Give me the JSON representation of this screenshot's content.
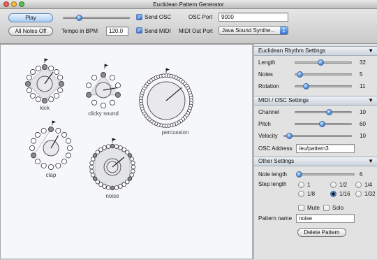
{
  "window": {
    "title": "Euclidean Pattern Generator"
  },
  "toolbar": {
    "play_label": "Play",
    "all_notes_off_label": "All Notes Off",
    "tempo_label": "Tempo in BPM",
    "tempo_value": "120.0",
    "send_osc_label": "Send OSC",
    "send_osc_checked": true,
    "send_midi_label": "Send MIDI",
    "send_midi_checked": true,
    "osc_port_label": "OSC Port",
    "osc_port_value": "9000",
    "midi_out_port_label": "MIDI Out Port",
    "midi_out_port_value": "Java Sound Synthe...",
    "volume_fraction": 0.24
  },
  "patterns": [
    {
      "name": "kick",
      "steps": 16,
      "hits": [
        0,
        4,
        8,
        12
      ],
      "shape": "square-ish"
    },
    {
      "name": "clicky sound",
      "steps": 10,
      "hits": [
        0,
        3,
        7
      ],
      "shape": "triangle"
    },
    {
      "name": "percussion",
      "steps": 60,
      "hits": [],
      "shape": "ring"
    },
    {
      "name": "clap",
      "steps": 16,
      "hits": [
        0,
        11
      ],
      "shape": "line"
    },
    {
      "name": "noise",
      "steps": 32,
      "hits": [
        0,
        5,
        11,
        16,
        21,
        27
      ],
      "shape": "hexagon"
    }
  ],
  "euclidean_settings": {
    "header": "Euclidean Rhythm Settings",
    "length_label": "Length",
    "length_value": "32",
    "length_fraction": 0.45,
    "notes_label": "Notes",
    "notes_value": "5",
    "notes_fraction": 0.08,
    "rotation_label": "Rotation",
    "rotation_value": "11",
    "rotation_fraction": 0.2
  },
  "midi_osc_settings": {
    "header": "MIDI / OSC Settings",
    "channel_label": "Channel",
    "channel_value": "10",
    "channel_fraction": 0.6,
    "pitch_label": "Pitch",
    "pitch_value": "60",
    "pitch_fraction": 0.47,
    "velocity_label": "Velocity",
    "velocity_value": "10",
    "velocity_fraction": 0.08,
    "osc_address_label": "OSC Address",
    "osc_address_value": "/eu/pattern3"
  },
  "other_settings": {
    "header": "Other Settings",
    "note_length_label": "Note length",
    "note_length_value": "6",
    "note_length_fraction": 0.03,
    "step_length_label": "Step length",
    "step_options": [
      "1",
      "1/2",
      "1/4",
      "1/8",
      "1/16",
      "1/32"
    ],
    "step_selected": "1/16",
    "mute_label": "Mute",
    "solo_label": "Solo",
    "mute_checked": false,
    "solo_checked": false,
    "pattern_name_label": "Pattern name",
    "pattern_name_value": "noise",
    "delete_button_label": "Delete Pattern"
  },
  "colors": {
    "slider_knob": "#4f8fd8",
    "hit_fill": "#8a8a8a",
    "step_fill": "#ffffff"
  }
}
